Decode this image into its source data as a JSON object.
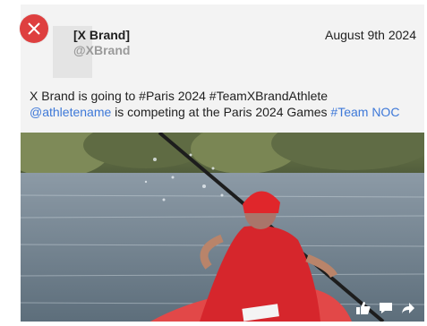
{
  "post": {
    "brand_name": "[X Brand]",
    "handle": "@XBrand",
    "date": "August 9th 2024",
    "line1": "X Brand is going to #Paris 2024 #TeamXBrandAthlete",
    "mention": "@athletename",
    "line2_middle": " is competing at the Paris 2024 Games ",
    "hashtag": "#Team NOC"
  },
  "media": {
    "description_icon": "kayak-athlete-photo"
  },
  "actions": [
    {
      "icon": "thumbs-up-icon"
    },
    {
      "icon": "comment-icon"
    },
    {
      "icon": "share-arrow-icon"
    }
  ],
  "colors": {
    "close": "#de3f3f",
    "link": "#3d78d8",
    "card": "#f3f3f3"
  }
}
